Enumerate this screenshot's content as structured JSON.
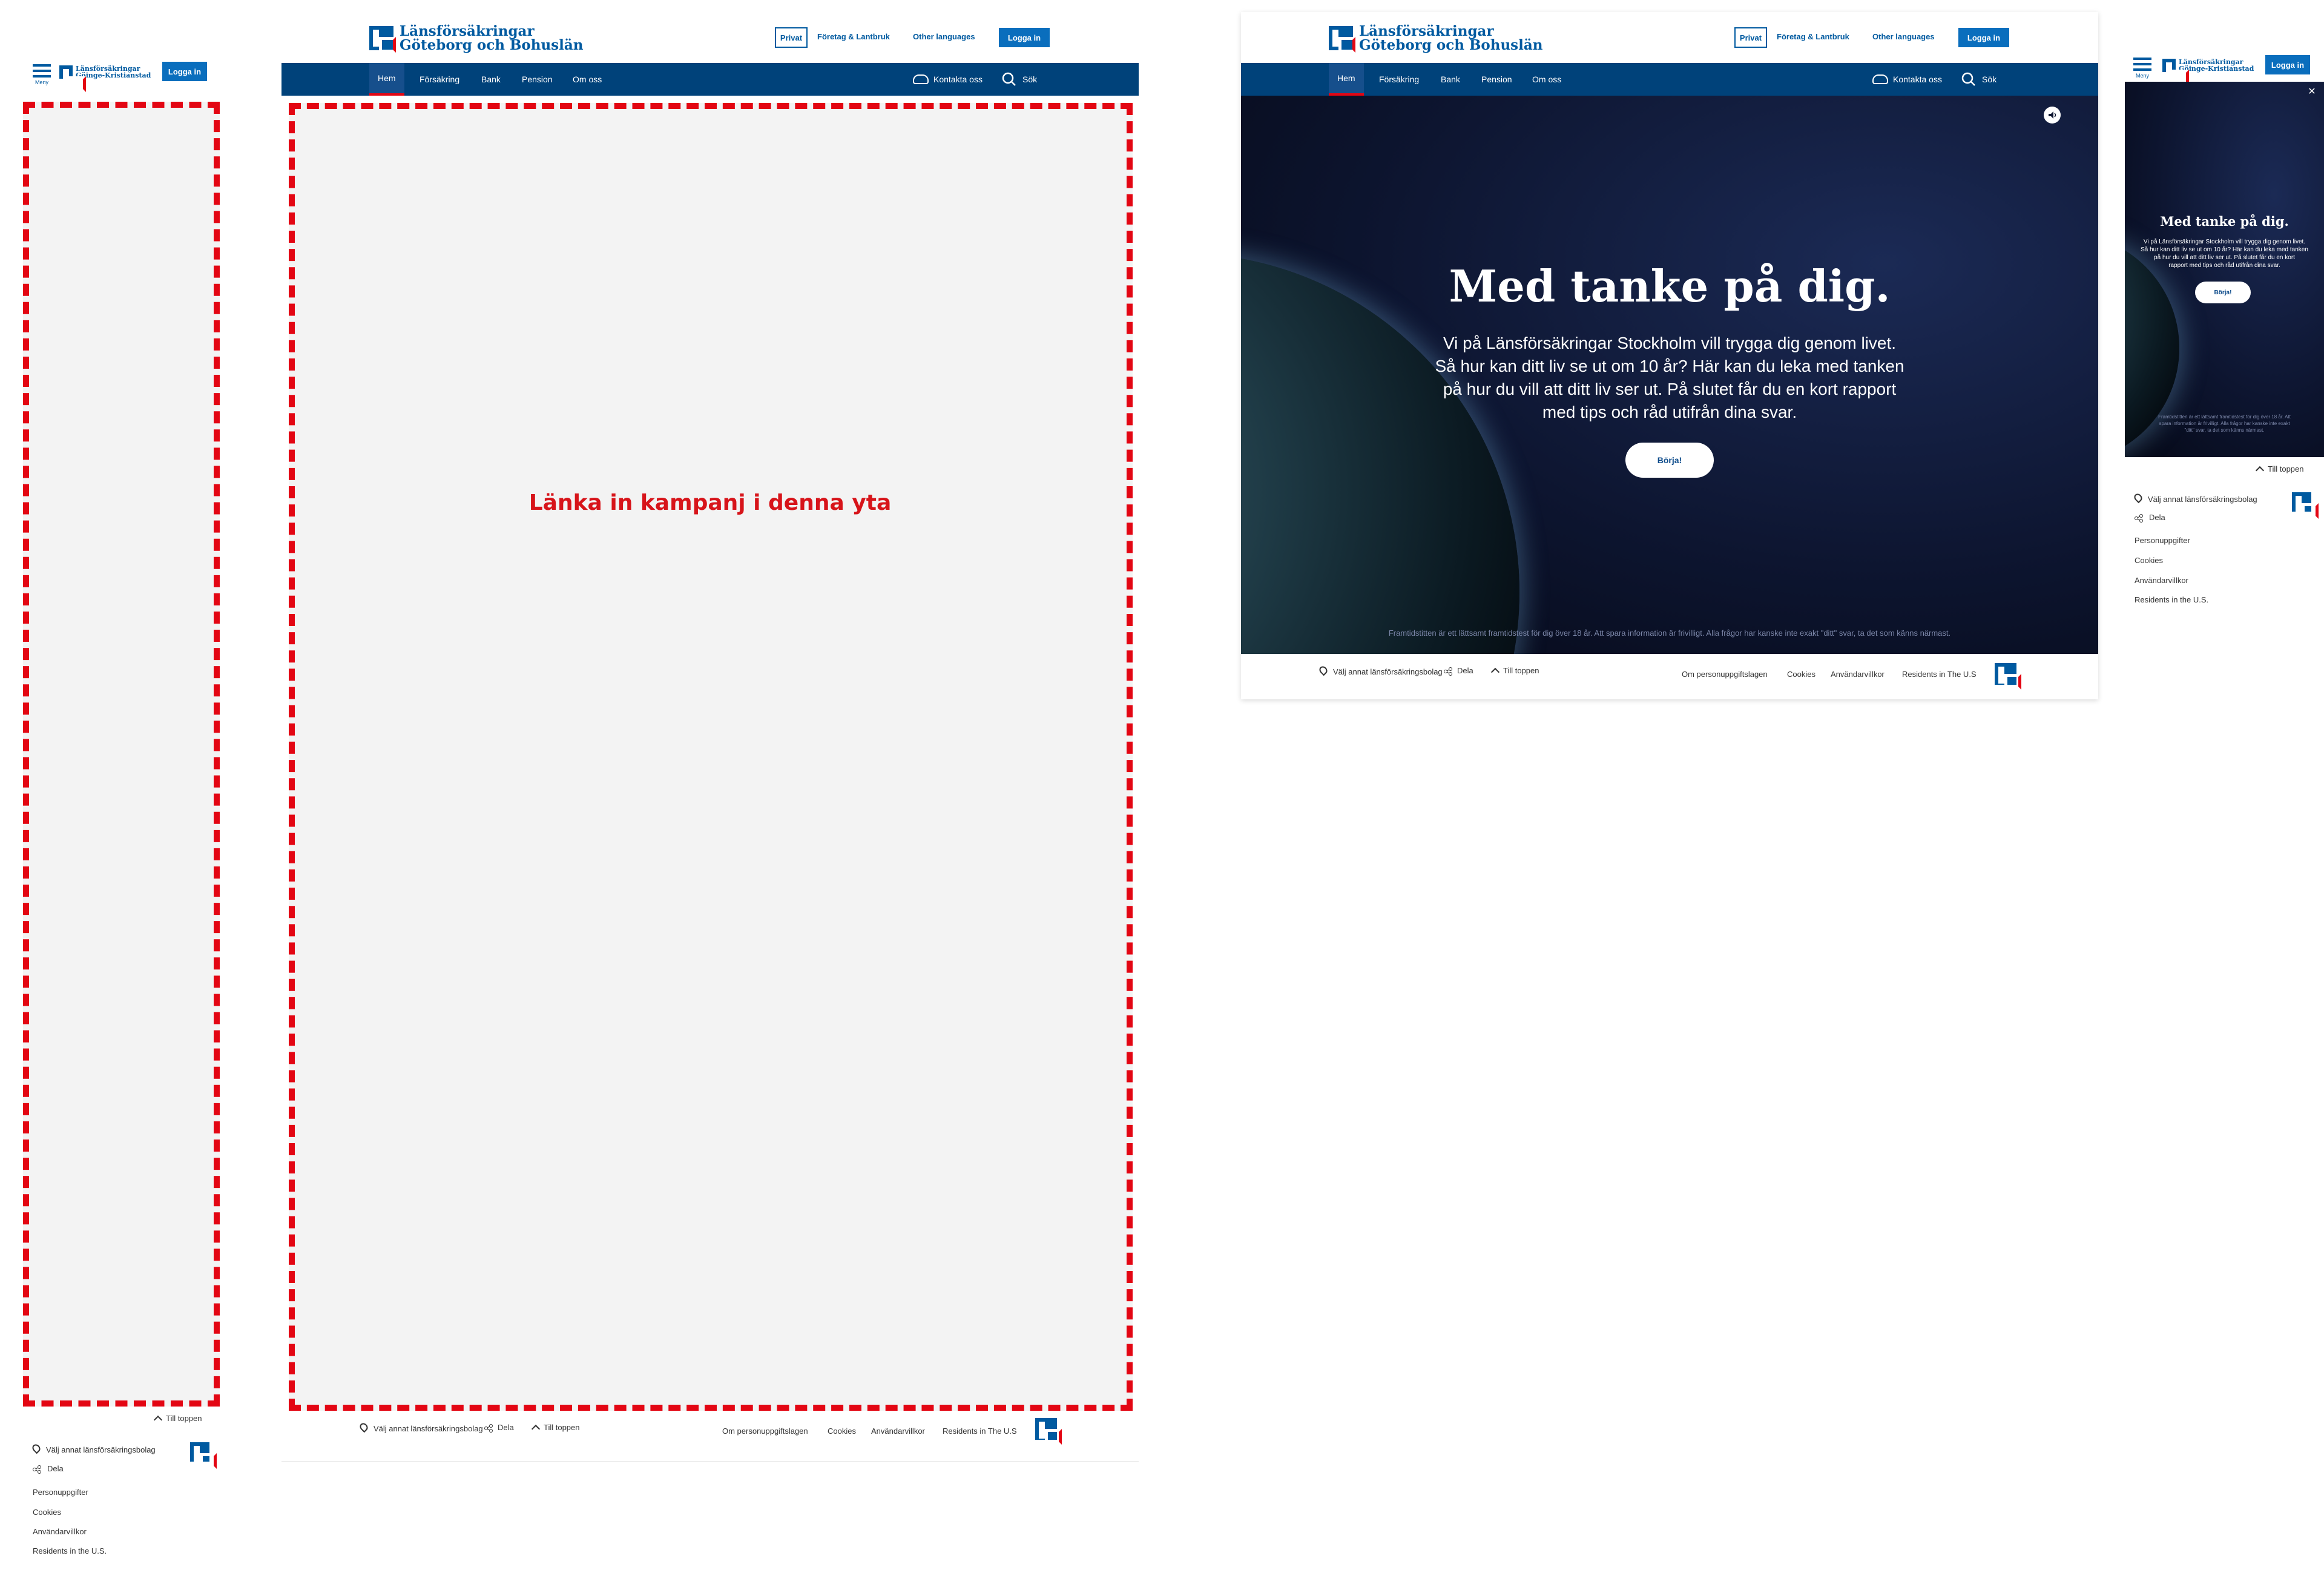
{
  "brand": {
    "gbg_line1": "Länsförsäkringar",
    "gbg_line2": "Göteborg och Bohuslän",
    "gk_line1": "Länsförsäkringar",
    "gk_line2": "Göinge-Kristianstad"
  },
  "top": {
    "privat": "Privat",
    "foretag": "Företag & Lantbruk",
    "other_languages": "Other languages",
    "login": "Logga in",
    "menu": "Meny"
  },
  "nav": {
    "items": [
      "Hem",
      "Försäkring",
      "Bank",
      "Pension",
      "Om oss"
    ],
    "contact": "Kontakta oss",
    "search": "Sök"
  },
  "placeholder": {
    "campaign": "Länka in kampanj i denna yta"
  },
  "hero": {
    "title": "Med tanke på dig.",
    "body_lines": [
      "Vi på Länsförsäkringar Stockholm vill trygga dig genom livet.",
      "Så hur kan ditt liv se ut om 10 år? Här kan du leka med tanken",
      "på hur du vill att ditt liv ser ut. På slutet får du en kort rapport",
      "med tips och råd utifrån dina svar."
    ],
    "button": "Börja!",
    "note": "Framtidstitten är ett lättsamt framtidstest för dig över 18 år. Att spara information är frivilligt. Alla frågor har kanske inte exakt \"ditt\" svar, ta det som känns närmast."
  },
  "mobile_hero": {
    "title": "Med tanke på dig.",
    "body_lines": [
      "Vi på Länsförsäkringar Stockholm vill trygga dig genom livet.",
      "Så hur kan ditt liv se ut om 10 år? Här kan du leka med tanken",
      "på hur du vill att ditt liv ser ut. På slutet får du en kort",
      "rapport med tips och råd utifrån dina svar."
    ],
    "button": "Börja!",
    "note_lines": [
      "Framtidstitten är ett lättsamt framtidstest för dig över 18 år. Att",
      "spara information är frivilligt. Alla frågor har kanske inte exakt",
      "\"ditt\" svar, ta det som känns närmast."
    ]
  },
  "footer": {
    "choose_company": "Välj annat länsförsäkringsbolag",
    "share": "Dela",
    "to_top": "Till toppen",
    "personal_data": "Om personuppgiftslagen",
    "cookies": "Cookies",
    "terms": "Användarvillkor",
    "residents": "Residents in The U.S"
  },
  "mobile_footer": {
    "to_top": "Till toppen",
    "choose_company": "Välj annat länsförsäkringsbolag",
    "share": "Dela",
    "personal_data": "Personuppgifter",
    "cookies": "Cookies",
    "terms": "Användarvillkor",
    "residents": "Residents in the U.S."
  },
  "colors": {
    "brand_blue": "#005aa0",
    "nav_blue": "#00427a",
    "accent_red": "#e30613",
    "login_blue": "#0a6ebd"
  }
}
